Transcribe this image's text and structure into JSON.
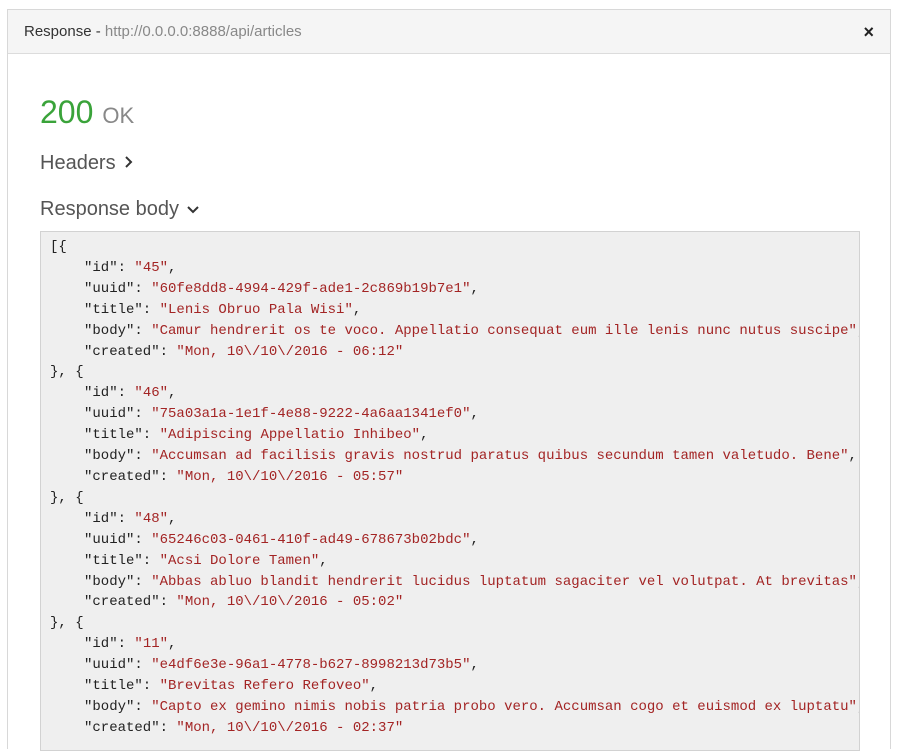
{
  "header": {
    "title": "Response - ",
    "url": "http://0.0.0.0:8888/api/articles",
    "close_icon": "×"
  },
  "status": {
    "code": "200",
    "text": "OK"
  },
  "sections": {
    "headers_label": "Headers",
    "headers_chevron": "›",
    "body_label": "Response body",
    "body_chevron": "⌄"
  },
  "colors": {
    "status_success": "#3aa33a",
    "string_value": "#a32424",
    "code_background": "#efefef"
  },
  "response_body": {
    "open_bracket": "[{",
    "separator": "}, {",
    "articles": [
      {
        "id": "45",
        "uuid": "60fe8dd8-4994-429f-ade1-2c869b19b7e1",
        "title": "Lenis Obruo Pala Wisi",
        "body": "Camur hendrerit os te voco. Appellatio consequat eum ille lenis nunc nutus suscipe",
        "created": "Mon, 10\\/10\\/2016 - 06:12"
      },
      {
        "id": "46",
        "uuid": "75a03a1a-1e1f-4e88-9222-4a6aa1341ef0",
        "title": "Adipiscing Appellatio Inhibeo",
        "body": "Accumsan ad facilisis gravis nostrud paratus quibus secundum tamen valetudo. Bene",
        "created": "Mon, 10\\/10\\/2016 - 05:57"
      },
      {
        "id": "48",
        "uuid": "65246c03-0461-410f-ad49-678673b02bdc",
        "title": "Acsi Dolore Tamen",
        "body": "Abbas abluo blandit hendrerit lucidus luptatum sagaciter vel volutpat. At brevitas",
        "created": "Mon, 10\\/10\\/2016 - 05:02"
      },
      {
        "id": "11",
        "uuid": "e4df6e3e-96a1-4778-b627-8998213d73b5",
        "title": "Brevitas Refero Refoveo",
        "body": "Capto ex gemino nimis nobis patria probo vero. Accumsan cogo et euismod ex luptatu",
        "created": "Mon, 10\\/10\\/2016 - 02:37"
      }
    ]
  }
}
